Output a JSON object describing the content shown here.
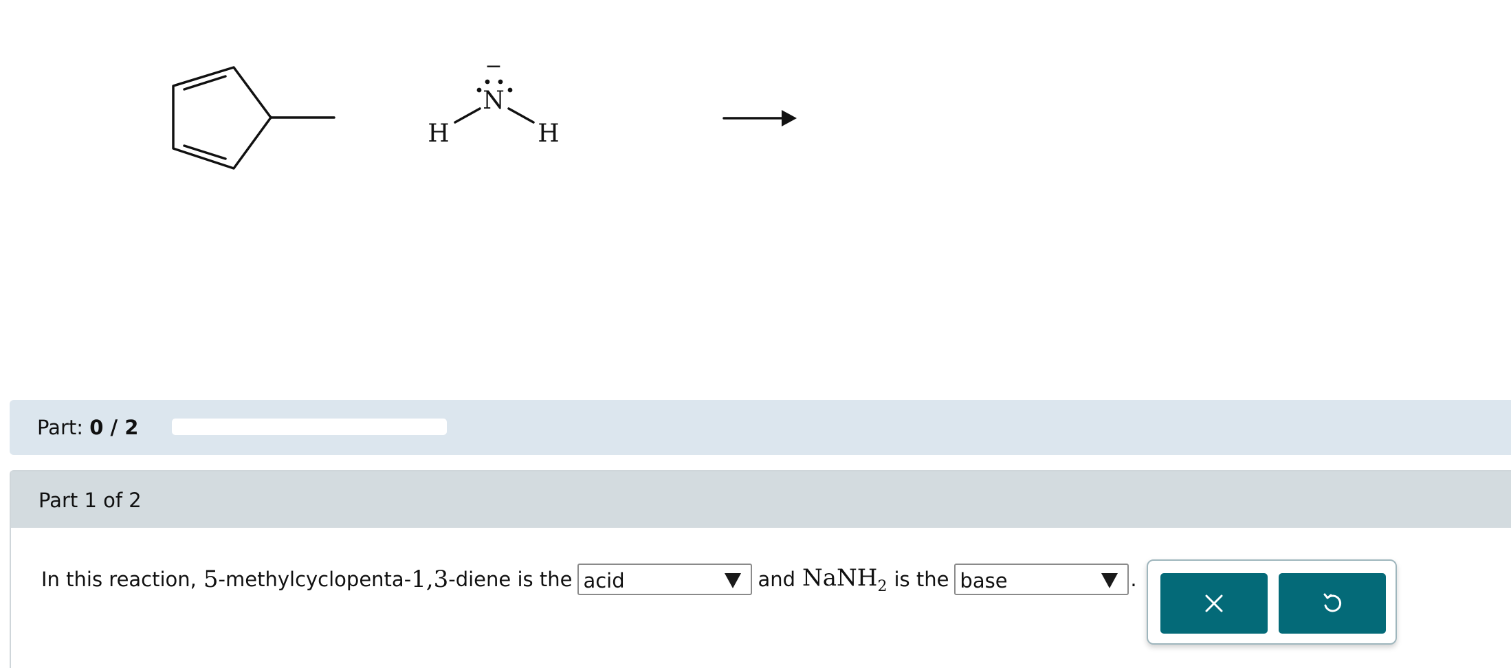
{
  "scheme": {
    "atoms": {
      "nitrogen": "N",
      "hydrogen_left": "H",
      "hydrogen_right": "H",
      "charge": "−"
    }
  },
  "part_bar": {
    "label": "Part:",
    "progress_text": "0 / 2",
    "completed": 0,
    "total": 2
  },
  "part_panel": {
    "title": "Part 1 of 2"
  },
  "question": {
    "text_1": "In this reaction,",
    "compound_num_1": "5",
    "compound_name_1": "-methylcyclopenta-",
    "compound_num_2": "1,3",
    "compound_name_2": "-diene is the",
    "text_and": "and",
    "reagent_main": "NaNH",
    "reagent_sub": "2",
    "text_is_the": "is the",
    "period": "."
  },
  "dropdowns": {
    "first": {
      "selected": "acid"
    },
    "second": {
      "selected": "base"
    }
  },
  "actions": {
    "clear_icon": "x-icon",
    "undo_icon": "undo-icon"
  },
  "colors": {
    "button_teal": "#046a78",
    "part_bar_bg": "#dce6ee",
    "part_header_bg": "#d3dbdf"
  }
}
